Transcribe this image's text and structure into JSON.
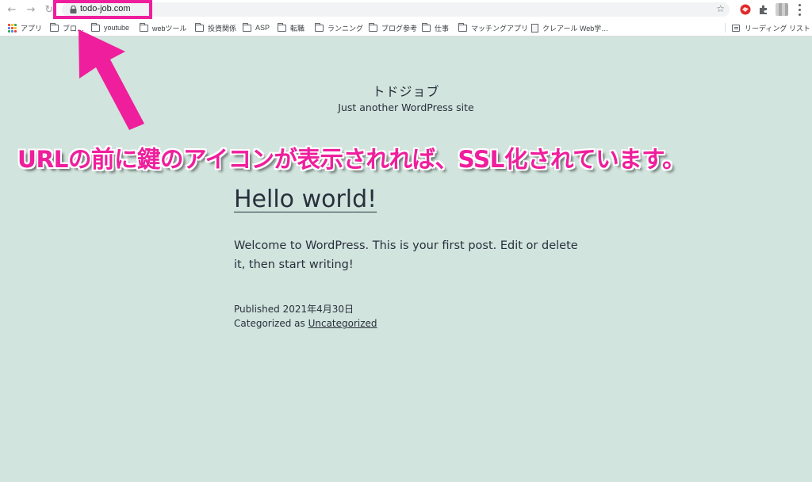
{
  "browser": {
    "url": "todo-job.com",
    "bookmarks": [
      {
        "label": "アプリ",
        "icon": "apps-grid-icon"
      },
      {
        "label": "ブロ…",
        "icon": "folder-icon"
      },
      {
        "label": "youtube",
        "icon": "folder-icon"
      },
      {
        "label": "webツール",
        "icon": "folder-icon"
      },
      {
        "label": "投資関係",
        "icon": "folder-icon"
      },
      {
        "label": "ASP",
        "icon": "folder-icon"
      },
      {
        "label": "転職",
        "icon": "folder-icon"
      },
      {
        "label": "ランニング",
        "icon": "folder-icon"
      },
      {
        "label": "ブログ参考",
        "icon": "folder-icon"
      },
      {
        "label": "仕事",
        "icon": "folder-icon"
      },
      {
        "label": "マッチングアプリ",
        "icon": "folder-icon"
      },
      {
        "label": "クレアール Web学…",
        "icon": "page-icon"
      }
    ],
    "reading_list": "リーディング リスト"
  },
  "site": {
    "title": "トドジョブ",
    "tagline": "Just another WordPress site"
  },
  "post": {
    "title": "Hello world!",
    "body": "Welcome to WordPress. This is your first post. Edit or delete it, then start writing!",
    "published_label": "Published 2021年4月30日",
    "categorized_prefix": "Categorized as ",
    "category": "Uncategorized"
  },
  "annotation": {
    "text": "URLの前に鍵のアイコンが表示されれば、SSL化されています。",
    "color": "#ef1e9c"
  }
}
